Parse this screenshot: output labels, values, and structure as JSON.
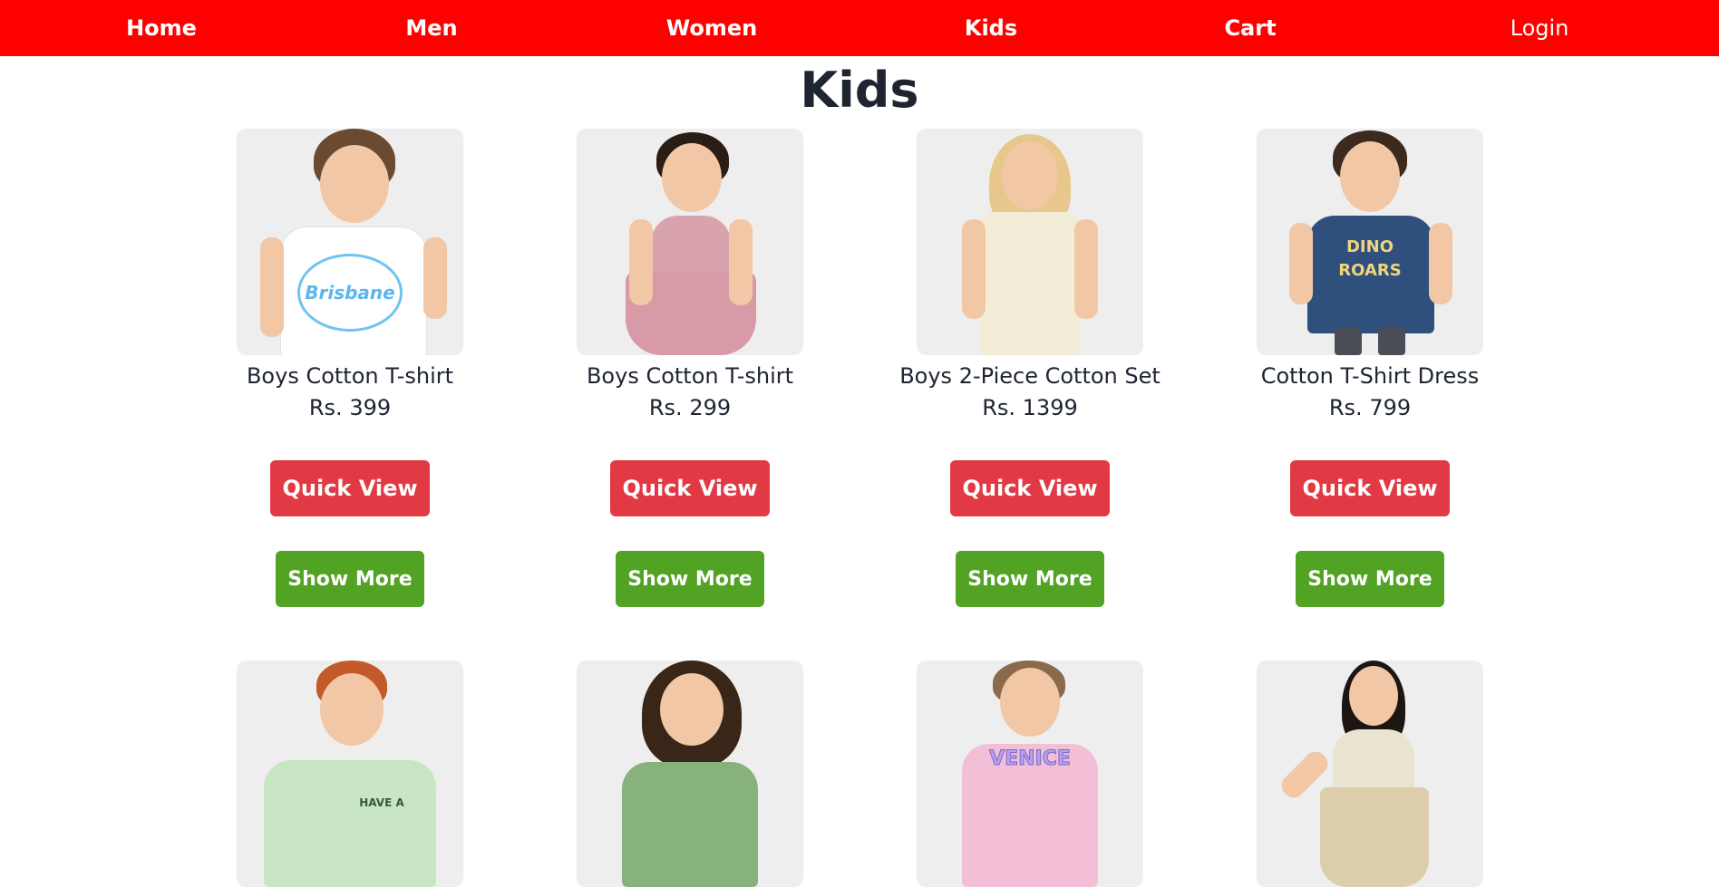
{
  "nav": {
    "home": "Home",
    "men": "Men",
    "women": "Women",
    "kids": "Kids",
    "cart": "Cart",
    "login": "Login"
  },
  "page": {
    "title": "Kids"
  },
  "products": [
    {
      "name": "Boys Cotton T-shirt",
      "price": "Rs. 399",
      "print": "Brisbane"
    },
    {
      "name": "Boys Cotton T-shirt",
      "price": "Rs. 299",
      "print": ""
    },
    {
      "name": "Boys 2-Piece Cotton Set",
      "price": "Rs. 1399",
      "print": ""
    },
    {
      "name": "Cotton T-Shirt Dress",
      "price": "Rs. 799",
      "print": "DINO ROARS"
    },
    {
      "print": "HAVE A"
    },
    {
      "print": ""
    },
    {
      "print": "VENICE"
    },
    {
      "print": ""
    }
  ],
  "buttons": {
    "quick_view": "Quick View",
    "show_more": "Show More"
  },
  "colors": {
    "navbar": "#ff0000",
    "quick_view": "#e23a44",
    "show_more": "#52a223",
    "text": "#1e2530"
  }
}
